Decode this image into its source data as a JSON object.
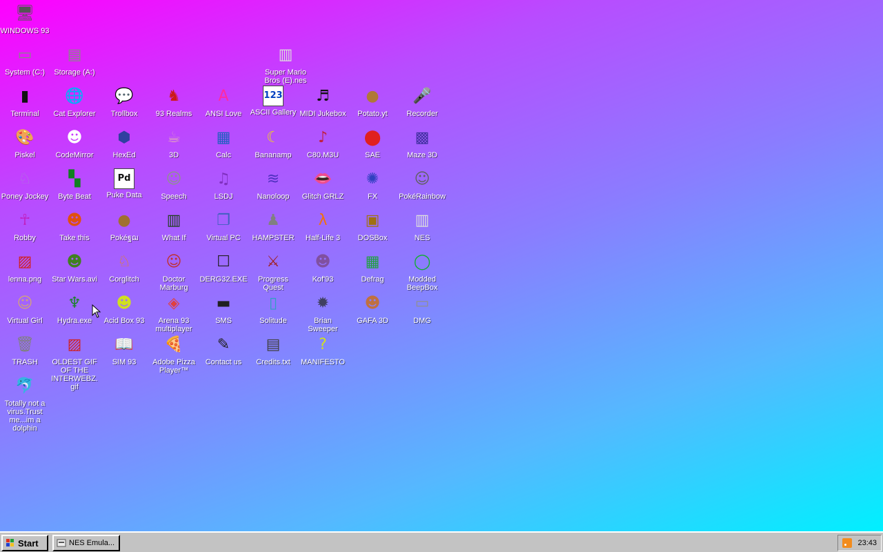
{
  "desktop": {
    "icons": [
      {
        "label": "WINDOWS 93",
        "icon": "computer-icon",
        "glyph": "🖥",
        "color": "#555555",
        "col": 0,
        "row": 0
      },
      {
        "label": "System (C:)",
        "icon": "drive-c-icon",
        "glyph": "▭",
        "color": "#888888",
        "col": 0,
        "row": 1
      },
      {
        "label": "Storage (A:)",
        "icon": "floppy-drive-icon",
        "glyph": "▤",
        "color": "#888888",
        "col": 1,
        "row": 1
      },
      {
        "label": "Super Mario Bros (E).nes",
        "icon": "nes-rom-icon",
        "glyph": "▥",
        "color": "#dddddd",
        "col": 5.25,
        "row": 1
      },
      {
        "label": "Terminal",
        "icon": "terminal-icon",
        "glyph": "▮",
        "color": "#111111",
        "col": 0,
        "row": 2
      },
      {
        "label": "Cat Explorer",
        "icon": "globe-icon",
        "glyph": "🌐",
        "color": "#2a7a3a",
        "col": 1,
        "row": 2
      },
      {
        "label": "Trollbox",
        "icon": "chat-bubble-icon",
        "glyph": "💬",
        "color": "#2aa0e0",
        "col": 2,
        "row": 2
      },
      {
        "label": "93 Realms",
        "icon": "mage-icon",
        "glyph": "♞",
        "color": "#cc1a1a",
        "col": 3,
        "row": 2
      },
      {
        "label": "ANSI Love",
        "icon": "ansi-icon",
        "glyph": "A",
        "color": "#ff2aa0",
        "col": 4,
        "row": 2
      },
      {
        "label": "ASCII Gallery",
        "icon": "ascii-icon",
        "glyph": "123",
        "color": "#0040c0",
        "col": 5,
        "row": 2
      },
      {
        "label": "MIDI Jukebox",
        "icon": "piano-icon",
        "glyph": "♬",
        "color": "#111111",
        "col": 6,
        "row": 2
      },
      {
        "label": "Potato.yt",
        "icon": "potato-icon",
        "glyph": "●",
        "color": "#b07838",
        "col": 7,
        "row": 2
      },
      {
        "label": "Recorder",
        "icon": "microphone-icon",
        "glyph": "🎤",
        "color": "#333333",
        "col": 8,
        "row": 2
      },
      {
        "label": "Piskel",
        "icon": "palette-icon",
        "glyph": "🎨",
        "color": "#d8a040",
        "col": 0,
        "row": 3
      },
      {
        "label": "CodeMirror",
        "icon": "codemirror-icon",
        "glyph": "☻",
        "color": "#ffffff",
        "col": 1,
        "row": 3
      },
      {
        "label": "HexEd",
        "icon": "cube-icon",
        "glyph": "⬢",
        "color": "#3040a0",
        "col": 2,
        "row": 3
      },
      {
        "label": "3D",
        "icon": "teapot-icon",
        "glyph": "☕",
        "color": "#e0a0c0",
        "col": 3,
        "row": 3
      },
      {
        "label": "Calc",
        "icon": "calculator-icon",
        "glyph": "▦",
        "color": "#2060c0",
        "col": 4,
        "row": 3
      },
      {
        "label": "Bananamp",
        "icon": "banana-icon",
        "glyph": "☾",
        "color": "#f0d020",
        "col": 5,
        "row": 3
      },
      {
        "label": "C80.M3U",
        "icon": "playlist-icon",
        "glyph": "♪",
        "color": "#c02040",
        "col": 6,
        "row": 3
      },
      {
        "label": "SAE",
        "icon": "checker-ball-icon",
        "glyph": "⬤",
        "color": "#e02020",
        "col": 7,
        "row": 3
      },
      {
        "label": "Maze 3D",
        "icon": "maze-icon",
        "glyph": "▩",
        "color": "#4030a0",
        "col": 8,
        "row": 3
      },
      {
        "label": "Poney Jockey",
        "icon": "pony-icon",
        "glyph": "♘",
        "color": "#b070e0",
        "col": 0,
        "row": 4
      },
      {
        "label": "Byte Beat",
        "icon": "bytebeat-icon",
        "glyph": "▚",
        "color": "#108020",
        "col": 1,
        "row": 4
      },
      {
        "label": "Puke Data",
        "icon": "pd-icon",
        "glyph": "Pd",
        "color": "#111111",
        "col": 2,
        "row": 4
      },
      {
        "label": "Speech",
        "icon": "speech-face-icon",
        "glyph": "☺",
        "color": "#909090",
        "col": 3,
        "row": 4
      },
      {
        "label": "LSDJ",
        "icon": "lsdj-icon",
        "glyph": "♫",
        "color": "#8030c0",
        "col": 4,
        "row": 4
      },
      {
        "label": "Nanoloop",
        "icon": "waveform-icon",
        "glyph": "≋",
        "color": "#5030c0",
        "col": 5,
        "row": 4
      },
      {
        "label": "Glitch GRLZ",
        "icon": "lips-icon",
        "glyph": "👄",
        "color": "#e02040",
        "col": 6,
        "row": 4
      },
      {
        "label": "FX",
        "icon": "atom-icon",
        "glyph": "✺",
        "color": "#3040c0",
        "col": 7,
        "row": 4
      },
      {
        "label": "PokéRainbow",
        "icon": "characters-icon",
        "glyph": "☺",
        "color": "#606060",
        "col": 8,
        "row": 4
      },
      {
        "label": "Robby",
        "icon": "stick-figure-icon",
        "glyph": "☥",
        "color": "#c020c0",
        "col": 0,
        "row": 5
      },
      {
        "label": "Take this",
        "icon": "pixel-man-icon",
        "glyph": "☻",
        "color": "#e05010",
        "col": 1,
        "row": 5
      },
      {
        "label": "Pokéฐฌ",
        "icon": "pokeball-icon",
        "glyph": "●",
        "color": "#a07030",
        "col": 2,
        "row": 5
      },
      {
        "label": "What If",
        "icon": "matrix-icon",
        "glyph": "▥",
        "color": "#204020",
        "col": 3,
        "row": 5
      },
      {
        "label": "Virtual PC",
        "icon": "window-icon",
        "glyph": "❐",
        "color": "#4060c0",
        "col": 4,
        "row": 5
      },
      {
        "label": "HAMPSTER",
        "icon": "hamster-icon",
        "glyph": "♟",
        "color": "#808080",
        "col": 5,
        "row": 5
      },
      {
        "label": "Half-Life 3",
        "icon": "lambda-icon",
        "glyph": "λ",
        "color": "#f07010",
        "col": 6,
        "row": 5
      },
      {
        "label": "DOSBox",
        "icon": "dosbox-icon",
        "glyph": "▣",
        "color": "#a07010",
        "col": 7,
        "row": 5
      },
      {
        "label": "NES",
        "icon": "nes-console-icon",
        "glyph": "▥",
        "color": "#dddddd",
        "col": 8,
        "row": 5
      },
      {
        "label": "lenna.png",
        "icon": "image-file-icon",
        "glyph": "▨",
        "color": "#d02020",
        "col": 0,
        "row": 6
      },
      {
        "label": "Star Wars.avi",
        "icon": "yoda-icon",
        "glyph": "☻",
        "color": "#408020",
        "col": 1,
        "row": 6
      },
      {
        "label": "Corglitch",
        "icon": "corgi-icon",
        "glyph": "♘",
        "color": "#e08030",
        "col": 2,
        "row": 6
      },
      {
        "label": "Doctor Marburg",
        "icon": "doctor-icon",
        "glyph": "☺",
        "color": "#c03030",
        "col": 3,
        "row": 6
      },
      {
        "label": "DERG32.EXE",
        "icon": "monitor-face-icon",
        "glyph": "☐",
        "color": "#202020",
        "col": 4,
        "row": 6
      },
      {
        "label": "Progress Quest",
        "icon": "swords-icon",
        "glyph": "⚔",
        "color": "#a02020",
        "col": 5,
        "row": 6
      },
      {
        "label": "Kof'93",
        "icon": "fighter-icon",
        "glyph": "☻",
        "color": "#8050a0",
        "col": 6,
        "row": 6
      },
      {
        "label": "Defrag",
        "icon": "defrag-icon",
        "glyph": "▦",
        "color": "#20a040",
        "col": 7,
        "row": 6
      },
      {
        "label": "Modded BeepBox",
        "icon": "ring-icon",
        "glyph": "◯",
        "color": "#10b030",
        "col": 8,
        "row": 6
      },
      {
        "label": "Virtual Girl",
        "icon": "girl-face-icon",
        "glyph": "☺",
        "color": "#d0a080",
        "col": 0,
        "row": 7
      },
      {
        "label": "Hydra.exe",
        "icon": "hydra-icon",
        "glyph": "♆",
        "color": "#208030",
        "col": 1,
        "row": 7
      },
      {
        "label": "Acid Box 93",
        "icon": "smiley-icon",
        "glyph": "☻",
        "color": "#d0e020",
        "col": 2,
        "row": 7
      },
      {
        "label": "Arena 93 multiplayer",
        "icon": "color-cube-icon",
        "glyph": "◈",
        "color": "#e04040",
        "col": 3,
        "row": 7
      },
      {
        "label": "SMS",
        "icon": "console-icon",
        "glyph": "▬",
        "color": "#202020",
        "col": 4,
        "row": 7
      },
      {
        "label": "Solitude",
        "icon": "bottle-icon",
        "glyph": "▯",
        "color": "#30a0c0",
        "col": 5,
        "row": 7
      },
      {
        "label": "Brian Sweeper",
        "icon": "mine-icon",
        "glyph": "✹",
        "color": "#404060",
        "col": 6,
        "row": 7
      },
      {
        "label": "GAFA 3D",
        "icon": "doom-face-icon",
        "glyph": "☻",
        "color": "#c07040",
        "col": 7,
        "row": 7
      },
      {
        "label": "DMG",
        "icon": "gameboy-icon",
        "glyph": "▭",
        "color": "#909090",
        "col": 8,
        "row": 7
      },
      {
        "label": "TRASH",
        "icon": "trash-icon",
        "glyph": "🗑",
        "color": "#808080",
        "col": 0,
        "row": 8
      },
      {
        "label": "OLDEST GIF OF THE INTERWEBZ.gif",
        "icon": "gif-file-icon",
        "glyph": "▨",
        "color": "#d02020",
        "col": 1,
        "row": 8
      },
      {
        "label": "SIM 93",
        "icon": "book-icon",
        "glyph": "📖",
        "color": "#202020",
        "col": 2,
        "row": 8
      },
      {
        "label": "Adobe Pizza Player™",
        "icon": "pizza-icon",
        "glyph": "🍕",
        "color": "#d08030",
        "col": 3,
        "row": 8
      },
      {
        "label": "Contact us",
        "icon": "contact-icon",
        "glyph": "✎",
        "color": "#202020",
        "col": 4,
        "row": 8
      },
      {
        "label": "Credits.txt",
        "icon": "text-file-icon",
        "glyph": "▤",
        "color": "#404040",
        "col": 5,
        "row": 8
      },
      {
        "label": "MANIFESTO",
        "icon": "question-mark-icon",
        "glyph": "?",
        "color": "#d0e020",
        "col": 6,
        "row": 8
      },
      {
        "label": "Totally not a virus.Trust me...im a dolphin",
        "icon": "dolphin-icon",
        "glyph": "🐬",
        "color": "#2090c0",
        "col": 0,
        "row": 9
      }
    ]
  },
  "taskbar": {
    "start_label": "Start",
    "tasks": [
      {
        "label": "NES Emula..."
      }
    ],
    "clock": "23:43"
  }
}
